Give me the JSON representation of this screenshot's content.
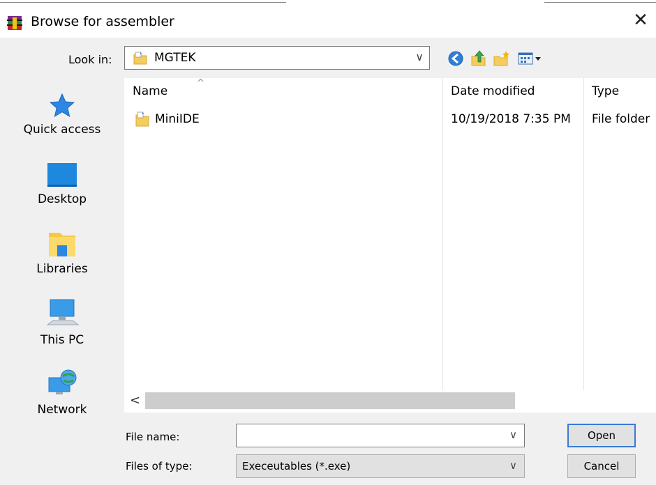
{
  "window": {
    "title": "Browse for assembler",
    "close_symbol": "✕",
    "app_icon": "winrar-books-icon"
  },
  "lookin": {
    "label": "Look in:",
    "value": "MGTEK",
    "folder_icon": "folder-icon",
    "chevron": "∨"
  },
  "toolbar": {
    "icons": [
      "back-icon",
      "up-folder-icon",
      "new-folder-icon",
      "view-menu-icon"
    ]
  },
  "places": [
    {
      "label": "Quick access",
      "icon": "star-icon"
    },
    {
      "label": "Desktop",
      "icon": "desktop-icon"
    },
    {
      "label": "Libraries",
      "icon": "libraries-icon"
    },
    {
      "label": "This PC",
      "icon": "computer-icon"
    },
    {
      "label": "Network",
      "icon": "network-icon"
    }
  ],
  "filelist": {
    "sort_caret": "^",
    "columns": [
      "Name",
      "Date modified",
      "Type"
    ],
    "rows": [
      {
        "name": "MiniIDE",
        "date": "10/19/2018 7:35 PM",
        "type": "File folder"
      }
    ]
  },
  "scroll": {
    "left_arrow": "<"
  },
  "form": {
    "filename_label": "File name:",
    "filename_value": "",
    "filetype_label": "Files of type:",
    "filetype_value": "Execeutables (*.exe)",
    "chevron": "∨",
    "open_label": "Open",
    "cancel_label": "Cancel"
  },
  "colors": {
    "accent": "#3a7bd5",
    "folder": "#f5cd5c",
    "background": "#f0f0f0"
  }
}
